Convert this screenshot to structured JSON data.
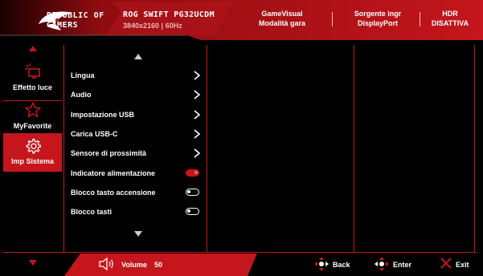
{
  "header": {
    "brand_line1": "REPUBLIC OF",
    "brand_line2": "GAMERS",
    "model": "ROG SWIFT PG32UCDM",
    "resolution": "3840x2160 |  60Hz",
    "status": [
      {
        "line1": "GameVisual",
        "line2": "Modalità gara"
      },
      {
        "line1": "Sorgente ingr",
        "line2": "DisplayPort"
      },
      {
        "line1": "HDR",
        "line2": "DISATTIVA"
      }
    ]
  },
  "sidebar": {
    "items": [
      {
        "label": "Effetto luce",
        "icon": "light-effect-icon",
        "active": false
      },
      {
        "label": "MyFavorite",
        "icon": "star-icon",
        "active": false
      },
      {
        "label": "Imp Sistema",
        "icon": "gear-icon",
        "active": true
      }
    ]
  },
  "menu": {
    "items": [
      {
        "label": "Lingua",
        "control": "chevron"
      },
      {
        "label": "Audio",
        "control": "chevron"
      },
      {
        "label": "Impostazione USB",
        "control": "chevron"
      },
      {
        "label": "Carica USB-C",
        "control": "chevron"
      },
      {
        "label": "Sensore di prossimità",
        "control": "chevron"
      },
      {
        "label": "Indicatore alimentazione",
        "control": "toggle",
        "state": "on"
      },
      {
        "label": "Blocco tasto accensione",
        "control": "toggle",
        "state": "off"
      },
      {
        "label": "Blocco tasti",
        "control": "toggle",
        "state": "off"
      }
    ]
  },
  "footer": {
    "volume_label": "Volume",
    "volume_value": "50",
    "back_label": "Back",
    "enter_label": "Enter",
    "exit_label": "Exit"
  },
  "colors": {
    "accent": "#c4161c",
    "background": "#000000",
    "text": "#ffffff"
  }
}
